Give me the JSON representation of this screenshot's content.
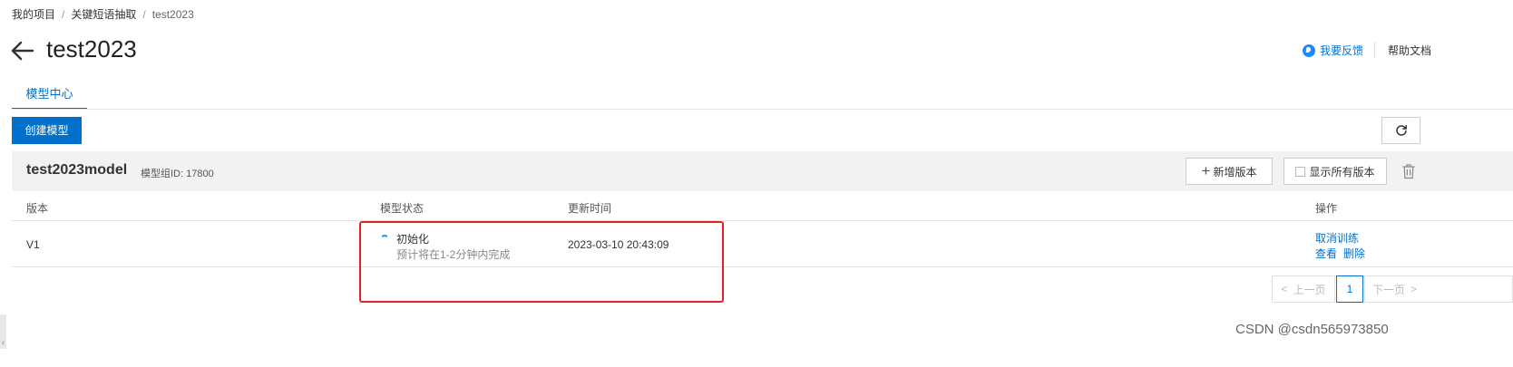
{
  "breadcrumb": {
    "items": [
      "我的项目",
      "关键短语抽取",
      "test2023"
    ],
    "separator": "/"
  },
  "header": {
    "title": "test2023",
    "feedback_label": "我要反馈",
    "help_label": "帮助文档"
  },
  "tabs": [
    {
      "label": "模型中心",
      "active": true
    }
  ],
  "toolbar": {
    "create_label": "创建模型",
    "refresh_icon": "refresh-icon"
  },
  "model_group": {
    "name": "test2023model",
    "id_text": "模型组ID: 17800",
    "new_version_label": "新增版本",
    "show_all_label": "显示所有版本",
    "delete_icon": "trash-icon"
  },
  "table": {
    "columns": [
      "版本",
      "模型状态",
      "更新时间",
      "操作"
    ],
    "rows": [
      {
        "version": "V1",
        "status": "初始化",
        "status_detail": "预计将在1-2分钟内完成",
        "updated": "2023-03-10 20:43:09",
        "actions": [
          "取消训练",
          "查看",
          "删除"
        ]
      }
    ]
  },
  "pagination": {
    "prev_label": "上一页",
    "current_page": "1",
    "next_label": "下一页"
  },
  "watermark": "CSDN @csdn565973850",
  "colors": {
    "accent": "#0070cc",
    "highlight_box": "#e52222",
    "group_header_bg": "#f2f2f2"
  }
}
